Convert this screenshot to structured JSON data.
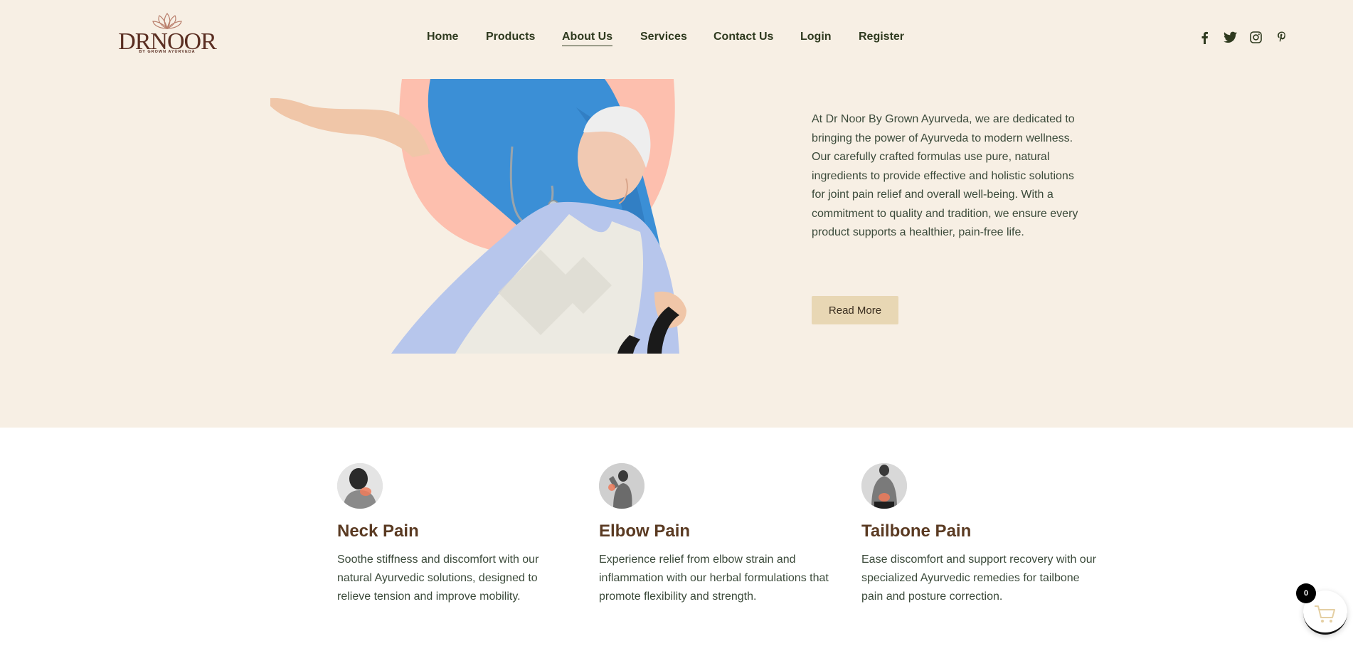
{
  "brand": {
    "name": "DRNOOR",
    "tagline": "BY GROWN AYURVEDA"
  },
  "nav": {
    "items": [
      {
        "label": "Home"
      },
      {
        "label": "Products"
      },
      {
        "label": "About Us"
      },
      {
        "label": "Services"
      },
      {
        "label": "Contact Us"
      },
      {
        "label": "Login"
      },
      {
        "label": "Register"
      }
    ],
    "active": "About Us"
  },
  "social": [
    "facebook-icon",
    "twitter-icon",
    "instagram-icon",
    "pinterest-icon"
  ],
  "about": {
    "text": "At Dr Noor By Grown Ayurveda, we are dedicated to bringing the power of Ayurveda to modern wellness. Our carefully crafted formulas use pure, natural ingredients to provide effective and holistic solutions for joint pain relief and overall well-being. With a commitment to quality and tradition, we ensure every product supports a healthier, pain-free life.",
    "button": "Read More"
  },
  "features": [
    {
      "title": "Neck Pain",
      "desc": "Soothe stiffness and discomfort with our natural Ayurvedic solutions, designed to relieve tension and improve mobility."
    },
    {
      "title": "Elbow Pain",
      "desc": "Experience relief from elbow strain and inflammation with our herbal formulations that promote flexibility and strength."
    },
    {
      "title": "Tailbone Pain",
      "desc": "Ease discomfort and support recovery with our specialized Ayurvedic remedies for tailbone pain and posture correction."
    }
  ],
  "cart": {
    "count": "0"
  },
  "colors": {
    "hero_bg": "#f7efe4",
    "nav_text": "#2f3a1f",
    "accent_button": "#e8d7b4",
    "feature_title": "#5a3a22",
    "brand": "#5a2e22",
    "blob": "#fdbfae"
  }
}
